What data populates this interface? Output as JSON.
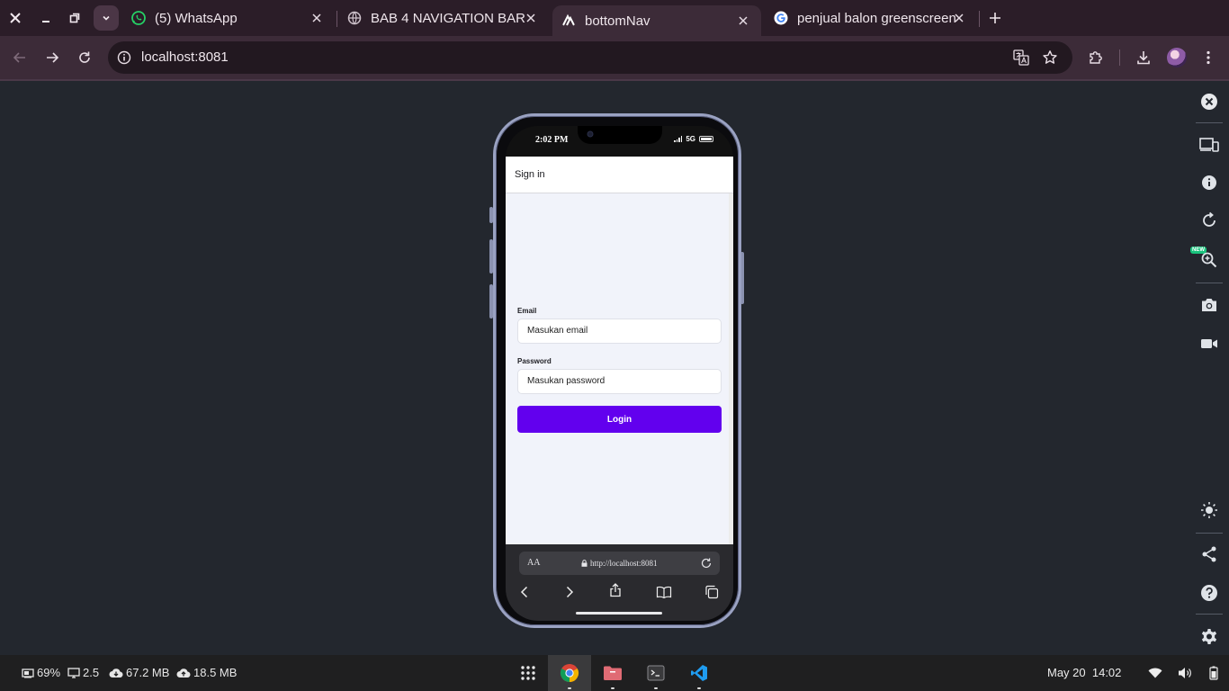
{
  "browser": {
    "tabs": [
      {
        "title": "(5) WhatsApp",
        "icon": "whatsapp-icon",
        "color": "#25d366"
      },
      {
        "title": "BAB 4 NAVIGATION BAR",
        "icon": "globe-icon",
        "color": "#cfc3cc"
      },
      {
        "title": "bottomNav",
        "icon": "expo-icon",
        "color": "#ffffff",
        "active": true
      },
      {
        "title": "penjual balon greenscreen",
        "icon": "google-icon",
        "color": "#4285f4"
      }
    ],
    "url": "localhost:8081"
  },
  "phone": {
    "status": {
      "time": "2:02 PM",
      "network": "5G"
    },
    "header_title": "Sign in",
    "form": {
      "email_label": "Email",
      "email_placeholder": "Masukan email",
      "password_label": "Password",
      "password_placeholder": "Masukan password",
      "login_label": "Login",
      "accent": "#6200ee"
    },
    "safari": {
      "aa": "AA",
      "url": "http://localhost:8081"
    }
  },
  "devtools": {
    "new_badge": "NEW"
  },
  "taskbar": {
    "battery": "69%",
    "display": "2.5",
    "download": "67.2 MB",
    "upload": "18.5 MB",
    "clock": "May 20  14:02"
  }
}
